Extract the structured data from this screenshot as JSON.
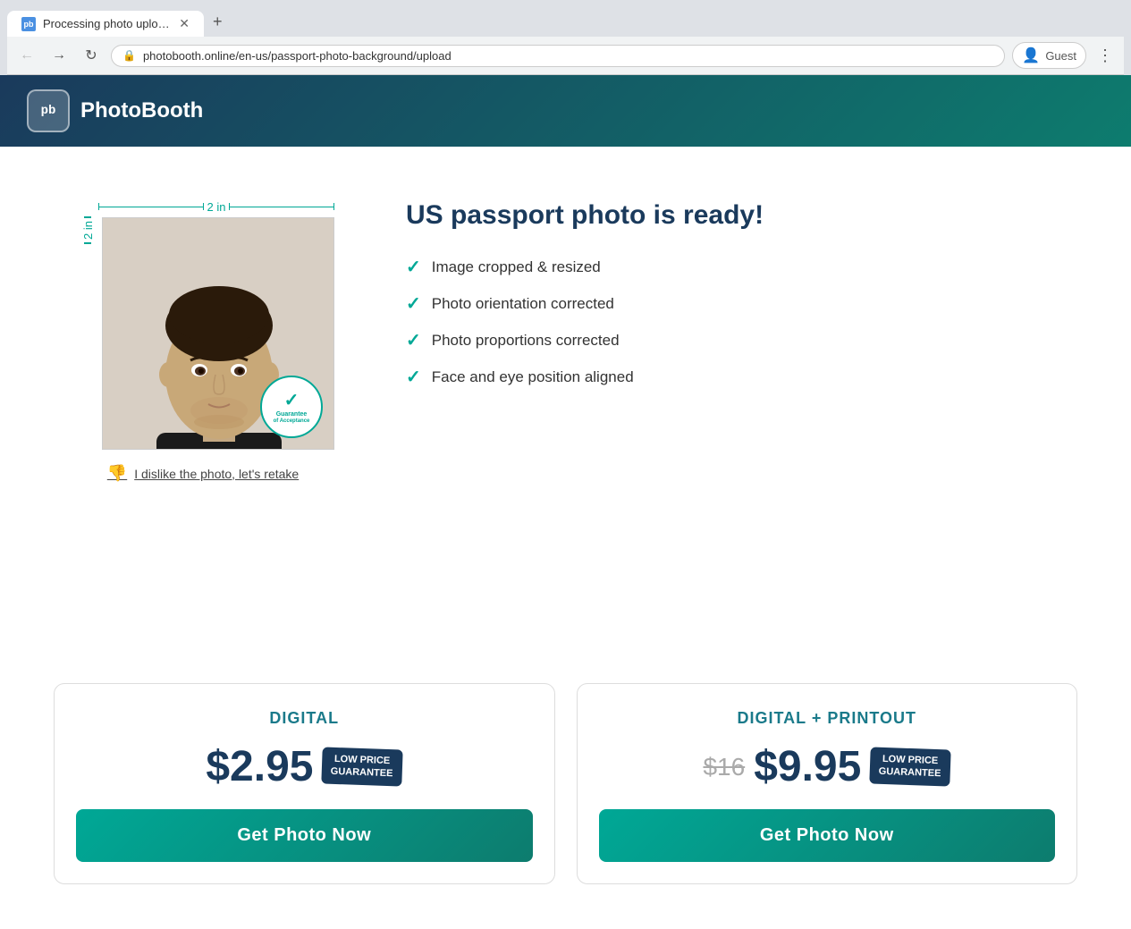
{
  "browser": {
    "tab_title": "Processing photo upload - P",
    "favicon_text": "pb",
    "url": "photobooth.online/en-us/passport-photo-background/upload",
    "new_tab_label": "+",
    "nav": {
      "back": "←",
      "forward": "→",
      "reload": "↻"
    },
    "profile_label": "Guest",
    "menu_label": "⋮"
  },
  "header": {
    "logo_text": "pb",
    "brand_name": "PhotoBooth"
  },
  "photo_section": {
    "dimension_top": "2 in",
    "dimension_left": "2 in",
    "guarantee_line1": "Guarantee",
    "guarantee_line2": "of Acceptance",
    "retake_text": "I dislike the photo, let's retake"
  },
  "info_section": {
    "title": "US passport photo is ready!",
    "features": [
      "Image cropped & resized",
      "Photo orientation corrected",
      "Photo proportions corrected",
      "Face and eye position aligned"
    ]
  },
  "pricing": {
    "digital": {
      "title": "DIGITAL",
      "price": "$2.95",
      "badge_line1": "LOW PRICE",
      "badge_line2": "GUARANTEE",
      "button_label": "Get Photo Now"
    },
    "digital_printout": {
      "title": "DIGITAL + PRINTOUT",
      "price_original": "$16",
      "price": "$9.95",
      "badge_line1": "LOW PRICE",
      "badge_line2": "GUARANTEE",
      "button_label": "Get Photo Now"
    }
  }
}
